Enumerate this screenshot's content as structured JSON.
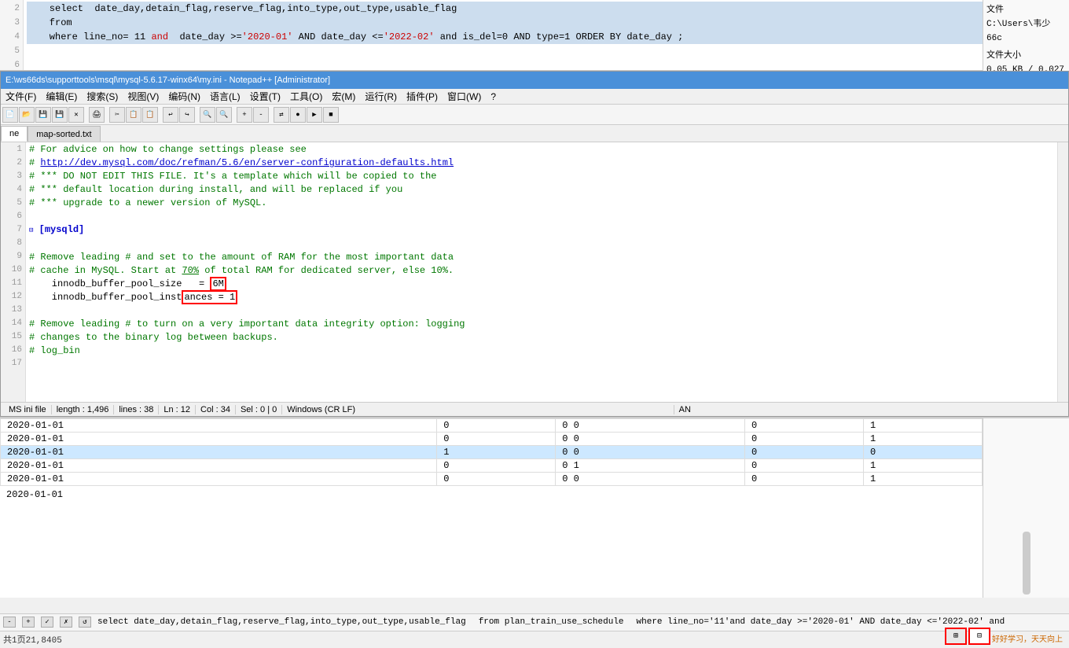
{
  "topQuery": {
    "lines": [
      {
        "num": "2",
        "content": "    select  date_day,detain_flag,reserve_flag,into_type,out_type,usable_flag",
        "highlight": true
      },
      {
        "num": "3",
        "content": ""
      },
      {
        "num": "4",
        "content": "    from",
        "highlight": true
      },
      {
        "num": "5",
        "content": "    where line_no= 11 and  date_day >='2020-01' AND date_day <='2022-02' and is_del=0 AND type=1 ORDER BY date_day ;",
        "highlight": true
      },
      {
        "num": "6",
        "content": ""
      }
    ]
  },
  "rightInfo": {
    "fileLabel": "文件",
    "filePath": "C:\\Users\\韦少66c",
    "sizeLabel": "文件大小",
    "sizeValue": "0.05 KB / 0.027"
  },
  "npp": {
    "title": "E:\\ws66ds\\supporttools\\msql\\mysql-5.6.17-winx64\\my.ini - Notepad++ [Administrator]",
    "menu": [
      "文件(F)",
      "编辑(E)",
      "搜索(S)",
      "视图(V)",
      "编码(N)",
      "语言(L)",
      "设置(T)",
      "工具(O)",
      "宏(M)",
      "运行(R)",
      "插件(P)",
      "窗口(W)",
      "?"
    ],
    "tabs": [
      {
        "label": "ne",
        "active": true
      },
      {
        "label": "map-sorted.txt",
        "active": false
      }
    ],
    "lines": [
      {
        "num": "1",
        "type": "comment",
        "text": "# For advice on how to change settings please see"
      },
      {
        "num": "2",
        "type": "link",
        "text": "# http://dev.mysql.com/doc/refman/5.6/en/server-configuration-defaults.html"
      },
      {
        "num": "3",
        "type": "comment",
        "text": "# *** DO NOT EDIT THIS FILE. It's a template which will be copied to the"
      },
      {
        "num": "4",
        "type": "comment",
        "text": "# *** default location during install, and will be replaced if you"
      },
      {
        "num": "5",
        "type": "comment",
        "text": "# *** upgrade to a newer version of MySQL."
      },
      {
        "num": "6",
        "type": "blank",
        "text": ""
      },
      {
        "num": "7",
        "type": "section",
        "text": "[mysqld]",
        "fold": true
      },
      {
        "num": "8",
        "type": "blank",
        "text": ""
      },
      {
        "num": "9",
        "type": "comment",
        "text": "# Remove leading # and set to the amount of RAM for the most important data"
      },
      {
        "num": "10",
        "type": "comment",
        "text": "# cache in MySQL. Start at 70% of total RAM for dedicated server, else 10%."
      },
      {
        "num": "11",
        "type": "keyval",
        "key": "innodb_buffer_pool_size",
        "val": " = 6M",
        "highlight_val": true
      },
      {
        "num": "12",
        "type": "keyval",
        "key": "innodb_buffer_pool_instances",
        "val": " = 1",
        "highlight_both": true
      },
      {
        "num": "13",
        "type": "blank",
        "text": ""
      },
      {
        "num": "14",
        "type": "comment",
        "text": "# Remove leading # to turn on a very important data integrity option: logging"
      },
      {
        "num": "15",
        "type": "comment",
        "text": "# changes to the binary log between backups."
      },
      {
        "num": "16",
        "type": "comment",
        "text": "# log_bin"
      },
      {
        "num": "17",
        "type": "blank",
        "text": ""
      }
    ],
    "statusbar": {
      "filetype": "MS ini file",
      "length": "length : 1,496",
      "lines": "lines : 38",
      "ln": "Ln : 12",
      "col": "Col : 34",
      "sel": "Sel : 0 | 0",
      "encoding": "Windows (CR LF)",
      "extra": "AN"
    }
  },
  "dataTable": {
    "rows": [
      {
        "date": "2020-01-01",
        "detain": "0",
        "r1": "0",
        "r2": "0",
        "into": "0",
        "usable": "1",
        "selected": false
      },
      {
        "date": "2020-01-01",
        "detain": "0",
        "r1": "0",
        "r2": "0",
        "into": "0",
        "usable": "1",
        "selected": false
      },
      {
        "date": "2020-01-01",
        "detain": "1",
        "r1": "0",
        "r2": "0",
        "into": "0",
        "usable": "0",
        "selected": false
      },
      {
        "date": "2020-01-01",
        "detain": "0",
        "r1": "0",
        "r2": "1",
        "into": "0",
        "usable": "1",
        "selected": false
      },
      {
        "date": "2020-01-01",
        "detain": "0",
        "r1": "0",
        "r2": "0",
        "into": "0",
        "usable": "1",
        "selected": false
      }
    ],
    "selectedDate": "2020-01-01"
  },
  "bottomBar": {
    "controls": [
      "-",
      "+",
      "✓",
      "✗",
      "↺"
    ],
    "sqlText": "select   date_day,detain_flag,reserve_flag,into_type,out_type,usable_flag",
    "fromText": "from plan_train_use_schedule",
    "whereText": "where line_no='11'and  date_day >='2020-01' AND date_day <='2022-02' and",
    "pageInfo": "共1页21,8405",
    "gridBtn1": "⊞",
    "gridBtn2": "⊟",
    "watermark": "好好学习，天天向上"
  }
}
